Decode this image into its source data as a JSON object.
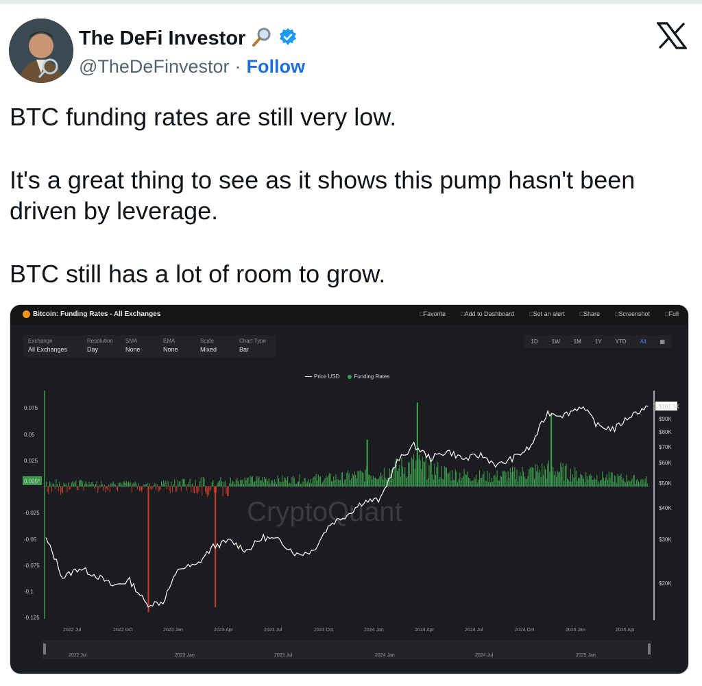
{
  "tweet": {
    "author_name": "The DeFi Investor",
    "handle": "@TheDeFinvestor",
    "separator": "·",
    "follow_label": "Follow",
    "paragraphs": [
      "BTC funding rates are still very low.",
      "It's a great thing to see as it shows this pump hasn't been driven by leverage.",
      "BTC still has a lot of room to grow."
    ]
  },
  "chart_card": {
    "title": "Bitcoin: Funding Rates - All Exchanges",
    "actions": [
      "Favorite",
      "Add to Dashboard",
      "Set an alert",
      "Share",
      "Screenshot",
      "Full"
    ],
    "controls": [
      {
        "label": "Exchange",
        "value": "All Exchanges"
      },
      {
        "label": "Resolution",
        "value": "Day"
      },
      {
        "label": "SMA",
        "value": "None"
      },
      {
        "label": "EMA",
        "value": "None"
      },
      {
        "label": "Scale",
        "value": "Mixed"
      },
      {
        "label": "Chart Type",
        "value": "Bar"
      }
    ],
    "ranges": [
      "1D",
      "1W",
      "1M",
      "1Y",
      "YTD",
      "All"
    ],
    "active_range": "All",
    "watermark": "CryptoQuant",
    "colors": {
      "positive": "#3b9a4d",
      "negative": "#c0392b",
      "price": "#ffffff",
      "bg": "#1b1c1f"
    }
  },
  "chart_data": {
    "type": "bar",
    "legend": [
      "Price USD",
      "Funding Rates"
    ],
    "left_axis_ticks": [
      "0.075",
      "0.05",
      "0.025",
      "0.005*",
      "-0.025",
      "-0.05",
      "-0.075",
      "-0.1",
      "-0.125"
    ],
    "right_axis_ticks": [
      "$101.7K",
      "$90K",
      "$80K",
      "$70K",
      "$60K",
      "$50K",
      "$40K",
      "$30K",
      "$20K"
    ],
    "x_ticks": [
      "2022 Jul",
      "2022 Oct",
      "2023 Jan",
      "2023 Apr",
      "2023 Jul",
      "2023 Oct",
      "2024 Jan",
      "2024 Apr",
      "2024 Jul",
      "2024 Oct",
      "2025 Jan",
      "2025 Apr"
    ],
    "navigator_ticks": [
      "2022 Jul",
      "2023 Jan",
      "2023 Jul",
      "2024 Jan",
      "2024 Jul",
      "2025 Jan"
    ],
    "funding_ylim": [
      -0.125,
      0.09
    ],
    "price_points": [
      {
        "x": "2022 May",
        "y": 30000
      },
      {
        "x": "2022 Jun",
        "y": 21000
      },
      {
        "x": "2022 Jul",
        "y": 23000
      },
      {
        "x": "2022 Aug",
        "y": 21500
      },
      {
        "x": "2022 Sep",
        "y": 19500
      },
      {
        "x": "2022 Oct",
        "y": 20500
      },
      {
        "x": "2022 Nov",
        "y": 16500
      },
      {
        "x": "2022 Dec",
        "y": 16800
      },
      {
        "x": "2023 Jan",
        "y": 23000
      },
      {
        "x": "2023 Feb",
        "y": 23500
      },
      {
        "x": "2023 Mar",
        "y": 28000
      },
      {
        "x": "2023 Apr",
        "y": 29500
      },
      {
        "x": "2023 May",
        "y": 27000
      },
      {
        "x": "2023 Jun",
        "y": 30500
      },
      {
        "x": "2023 Jul",
        "y": 29500
      },
      {
        "x": "2023 Aug",
        "y": 26000
      },
      {
        "x": "2023 Sep",
        "y": 27000
      },
      {
        "x": "2023 Oct",
        "y": 34500
      },
      {
        "x": "2023 Nov",
        "y": 37500
      },
      {
        "x": "2023 Dec",
        "y": 42500
      },
      {
        "x": "2024 Jan",
        "y": 43000
      },
      {
        "x": "2024 Feb",
        "y": 61000
      },
      {
        "x": "2024 Mar",
        "y": 71000
      },
      {
        "x": "2024 Apr",
        "y": 63000
      },
      {
        "x": "2024 May",
        "y": 67500
      },
      {
        "x": "2024 Jun",
        "y": 62500
      },
      {
        "x": "2024 Jul",
        "y": 65000
      },
      {
        "x": "2024 Aug",
        "y": 59000
      },
      {
        "x": "2024 Sep",
        "y": 63500
      },
      {
        "x": "2024 Oct",
        "y": 70000
      },
      {
        "x": "2024 Nov",
        "y": 96000
      },
      {
        "x": "2024 Dec",
        "y": 94000
      },
      {
        "x": "2025 Jan",
        "y": 102000
      },
      {
        "x": "2025 Feb",
        "y": 85000
      },
      {
        "x": "2025 Mar",
        "y": 82500
      },
      {
        "x": "2025 Apr",
        "y": 94000
      },
      {
        "x": "2025 May",
        "y": 101700
      }
    ],
    "funding_spikes": [
      {
        "x": "2022 Nov",
        "y": -0.12
      },
      {
        "x": "2023 Mar",
        "y": -0.115
      },
      {
        "x": "2024 Mar",
        "y": 0.08
      },
      {
        "x": "2024 Nov",
        "y": 0.07
      },
      {
        "x": "2023 Dec",
        "y": 0.045
      }
    ]
  }
}
